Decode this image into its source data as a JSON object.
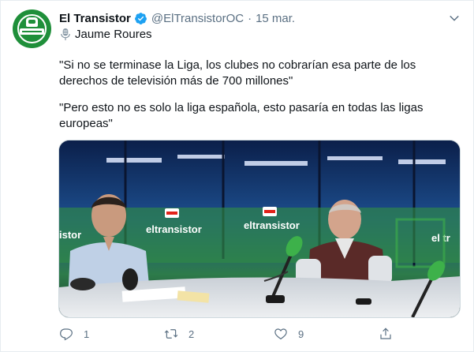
{
  "account": {
    "name": "El Transistor",
    "handle": "@ElTransistorOC",
    "separator": "·",
    "date": "15 mar.",
    "avatar_icon": "radio-microphone-logo",
    "brand_color": "#1f8f3a",
    "verified_color": "#1da1f2"
  },
  "tweet": {
    "speaker_icon": "microphone-icon",
    "speaker": "Jaume Roures",
    "paragraph_1": "\"Si no se terminase la Liga, los clubes no cobrarían esa parte de los derechos de televisión más de 700 millones\"",
    "paragraph_2": "\"Pero esto no es solo la liga española, esto pasaría en todas las ligas europeas\"",
    "media_logo_text": "eltransistor",
    "media_logo_partial_left": "istor",
    "media_logo_partial_right": "el tr",
    "media_badge": "ONDA CERO"
  },
  "actions": {
    "reply_count": "1",
    "retweet_count": "2",
    "like_count": "9",
    "muted_color": "#5b7083"
  }
}
